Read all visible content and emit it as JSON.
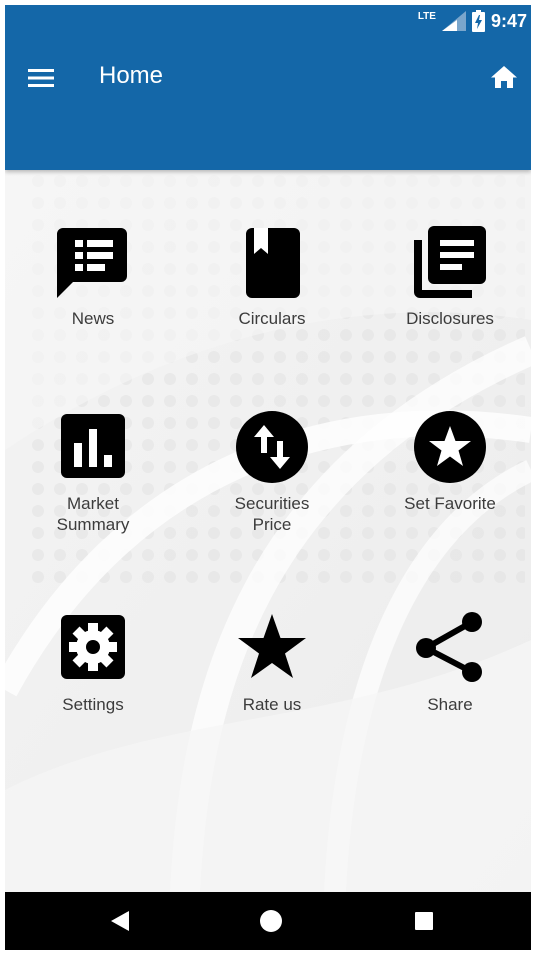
{
  "status_bar": {
    "network": "LTE",
    "time": "9:47",
    "icons": [
      "signal-icon",
      "battery-charging-icon"
    ]
  },
  "toolbar": {
    "title": "Home",
    "menu_icon": "hamburger-menu-icon",
    "home_icon": "home-icon"
  },
  "colors": {
    "app_bar": "#1467a8",
    "icon": "#000000",
    "label": "#3c3c3c"
  },
  "tiles": [
    {
      "label": "News",
      "icon": "news-chat-icon"
    },
    {
      "label": "Circulars",
      "icon": "bookmark-book-icon"
    },
    {
      "label": "Disclosures",
      "icon": "library-books-icon"
    },
    {
      "label": "Market\nSummary",
      "icon": "bar-chart-icon"
    },
    {
      "label": "Securities\nPrice",
      "icon": "swap-vertical-icon"
    },
    {
      "label": "Set Favorite",
      "icon": "star-circle-icon"
    },
    {
      "label": "Settings",
      "icon": "gear-icon"
    },
    {
      "label": "Rate us",
      "icon": "star-icon"
    },
    {
      "label": "Share",
      "icon": "share-icon"
    }
  ],
  "nav_bar": {
    "back_icon": "back-triangle-icon",
    "home_icon": "home-circle-icon",
    "recents_icon": "recents-square-icon"
  }
}
